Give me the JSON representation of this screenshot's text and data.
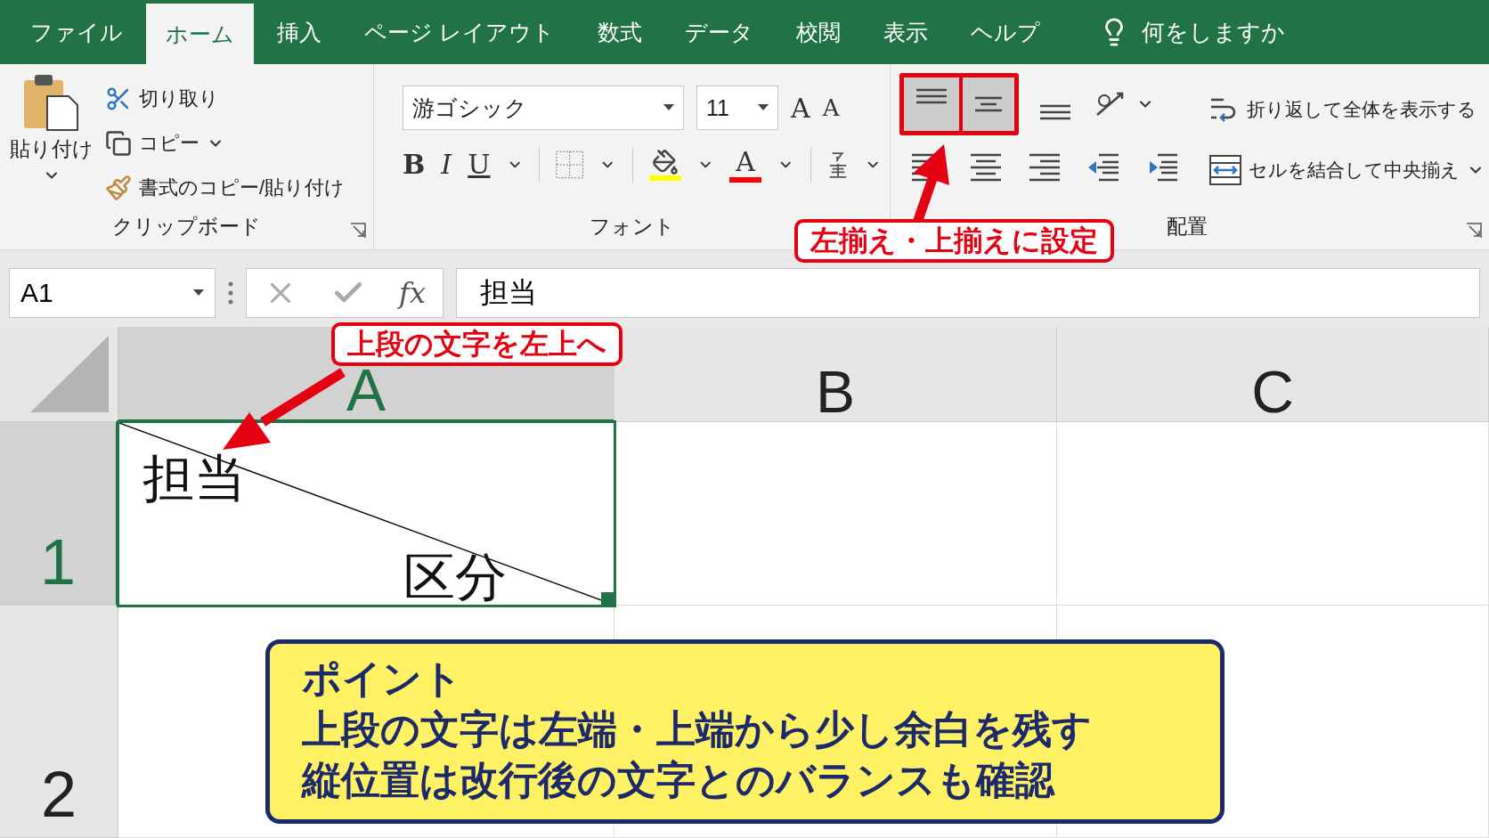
{
  "tabs": [
    {
      "label": "ファイル",
      "selected": false
    },
    {
      "label": "ホーム",
      "selected": true
    },
    {
      "label": "挿入",
      "selected": false
    },
    {
      "label": "ページ レイアウト",
      "selected": false
    },
    {
      "label": "数式",
      "selected": false
    },
    {
      "label": "データ",
      "selected": false
    },
    {
      "label": "校閲",
      "selected": false
    },
    {
      "label": "表示",
      "selected": false
    },
    {
      "label": "ヘルプ",
      "selected": false
    }
  ],
  "tell_me": "何をしますか",
  "ribbon": {
    "clipboard": {
      "paste": "貼り付け",
      "cut": "切り取り",
      "copy": "コピー",
      "format_painter": "書式のコピー/貼り付け",
      "group_label": "クリップボード"
    },
    "font": {
      "font_name": "游ゴシック",
      "font_size": "11",
      "grow": "A",
      "shrink": "A",
      "bold": "B",
      "italic": "I",
      "underline": "U",
      "font_color": "A",
      "group_label": "フォント"
    },
    "alignment": {
      "buttons": [
        {
          "kind": "top",
          "selected": true
        },
        {
          "kind": "middle",
          "selected": true
        },
        {
          "kind": "bottom",
          "selected": false
        },
        {
          "kind": "left",
          "selected": false
        },
        {
          "kind": "center",
          "selected": false
        },
        {
          "kind": "right",
          "selected": false
        },
        {
          "kind": "outdent",
          "selected": false
        },
        {
          "kind": "indent",
          "selected": false
        }
      ],
      "wrap_text": "折り返して全体を表示する",
      "merge": "セルを結合して中央揃え",
      "group_label": "配置"
    }
  },
  "formula_bar": {
    "name_box": "A1",
    "fx": "fx",
    "value": "担当"
  },
  "columns": [
    {
      "label": "A",
      "selected": true
    },
    {
      "label": "B",
      "selected": false
    },
    {
      "label": "C",
      "selected": false
    }
  ],
  "rows": [
    {
      "label": "1",
      "selected": true
    },
    {
      "label": "2",
      "selected": false
    }
  ],
  "cell_a1": {
    "top_text": "担当",
    "bottom_text": "区分",
    "selected": true
  },
  "callouts": [
    {
      "text": "左揃え・上揃えに設定"
    },
    {
      "text": "上段の文字を左上へ"
    }
  ],
  "point": {
    "title": "ポイント",
    "lines": [
      "上段の文字は左端・上端から少し余白を残す",
      "縦位置は改行後の文字とのバランスも確認"
    ]
  }
}
